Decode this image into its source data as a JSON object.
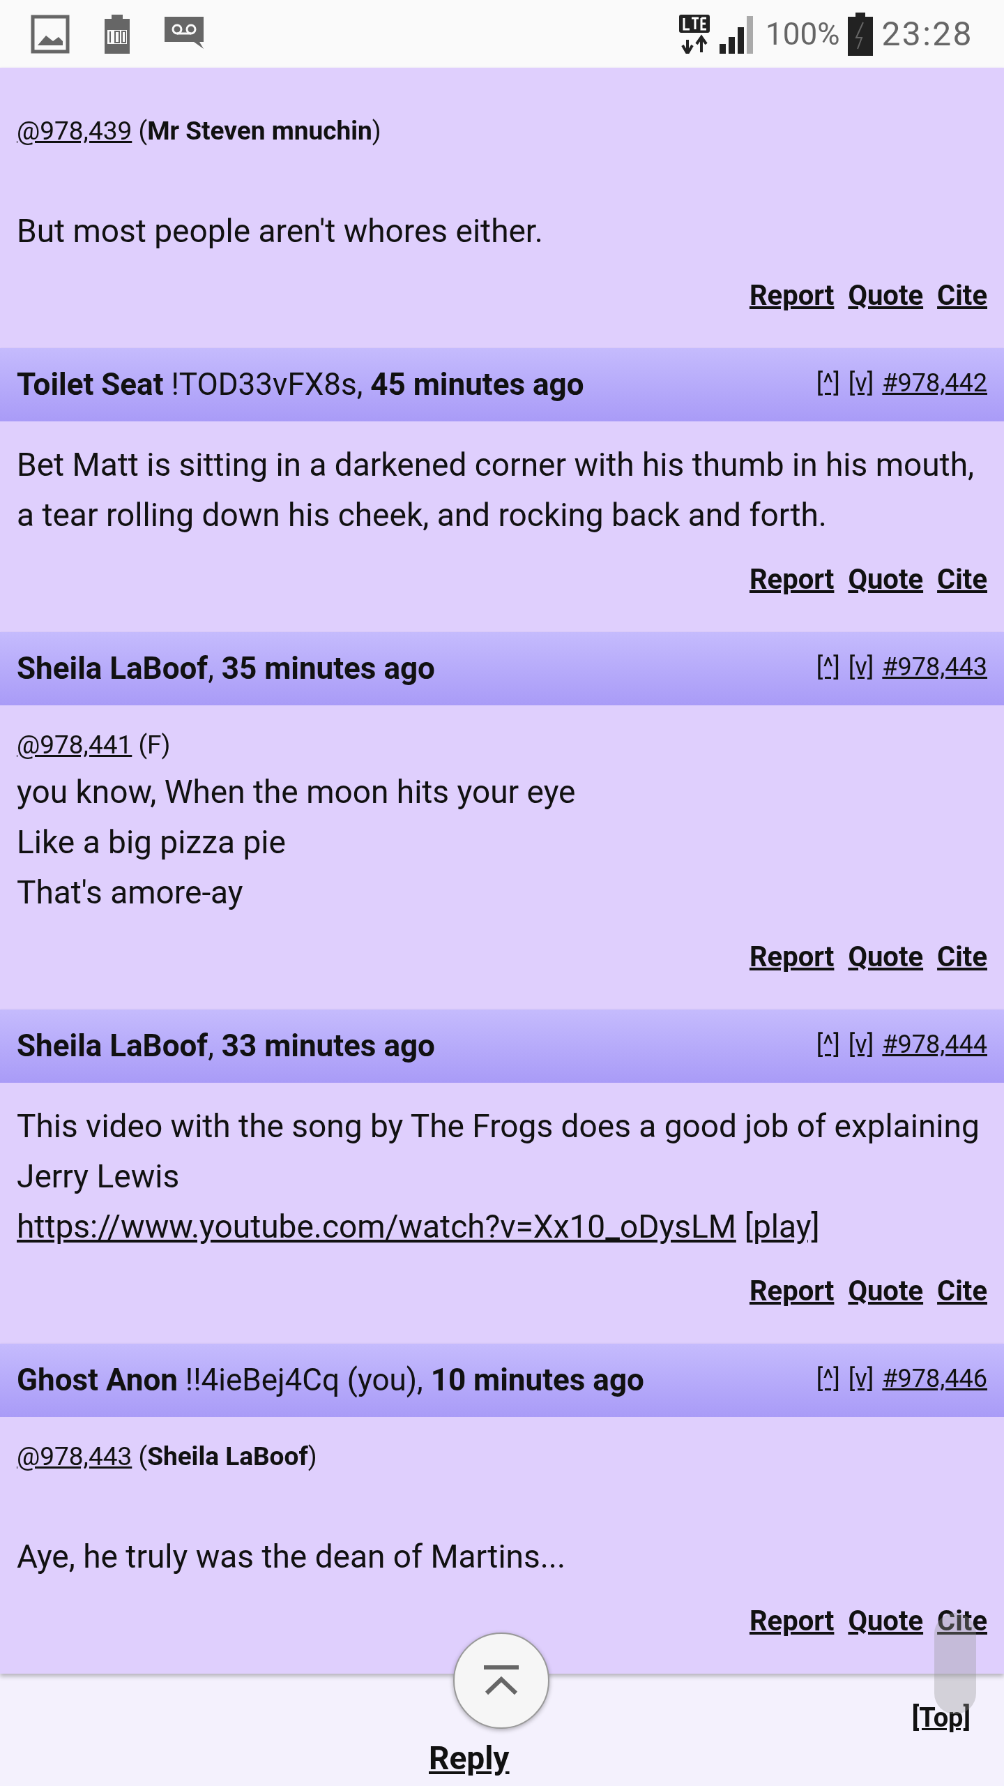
{
  "status_bar": {
    "battery": "100%",
    "time": "23:28"
  },
  "posts": [
    {
      "lines": [
        {
          "kind": "reference",
          "segments": [
            {
              "kind": "link",
              "text": "@978,439"
            },
            {
              "kind": "plain",
              "text": " ("
            },
            {
              "kind": "bold",
              "text": "Mr Steven mnuchin"
            },
            {
              "kind": "plain",
              "text": ")"
            }
          ]
        },
        {
          "kind": "paragraph",
          "segments": [
            {
              "kind": "plain",
              "text": "But most people aren't whores either."
            }
          ]
        }
      ],
      "actions": [
        "Report",
        "Quote",
        "Cite"
      ]
    },
    {
      "header": [
        {
          "kind": "bold",
          "text": "Toilet Seat"
        },
        {
          "kind": "plain",
          "text": " !TOD33vFX8s, "
        },
        {
          "kind": "bold",
          "text": "45 minutes ago"
        }
      ],
      "number_links": [
        "[^]",
        "[v]",
        "#978,442"
      ],
      "lines": [
        {
          "kind": "text",
          "segments": [
            {
              "kind": "plain",
              "text": "Bet Matt is sitting in a darkened corner with his thumb in his mouth, a tear rolling down his cheek, and rocking back and forth."
            }
          ]
        }
      ],
      "actions": [
        "Report",
        "Quote",
        "Cite"
      ]
    },
    {
      "header": [
        {
          "kind": "bold",
          "text": "Sheila LaBoof"
        },
        {
          "kind": "plain",
          "text": ", "
        },
        {
          "kind": "bold",
          "text": "35 minutes ago"
        }
      ],
      "number_links": [
        "[^]",
        "[v]",
        "#978,443"
      ],
      "lines": [
        {
          "kind": "reference",
          "segments": [
            {
              "kind": "link",
              "text": "@978,441"
            },
            {
              "kind": "plain",
              "text": " (F)"
            }
          ]
        },
        {
          "kind": "text",
          "segments": [
            {
              "kind": "plain",
              "text": "you know, When the moon hits your eye"
            }
          ]
        },
        {
          "kind": "text",
          "segments": [
            {
              "kind": "plain",
              "text": "Like a big pizza pie"
            }
          ]
        },
        {
          "kind": "text",
          "segments": [
            {
              "kind": "plain",
              "text": "That's amore-ay"
            }
          ]
        }
      ],
      "actions": [
        "Report",
        "Quote",
        "Cite"
      ]
    },
    {
      "header": [
        {
          "kind": "bold",
          "text": "Sheila LaBoof"
        },
        {
          "kind": "plain",
          "text": ", "
        },
        {
          "kind": "bold",
          "text": "33 minutes ago"
        }
      ],
      "number_links": [
        "[^]",
        "[v]",
        "#978,444"
      ],
      "lines": [
        {
          "kind": "text",
          "segments": [
            {
              "kind": "plain",
              "text": "This video with the song by The Frogs does a good job of explaining Jerry Lewis"
            }
          ]
        },
        {
          "kind": "text",
          "segments": [
            {
              "kind": "link",
              "text": "https://www.youtube.com/watch?v=Xx10_oDysLM"
            },
            {
              "kind": "link",
              "text": "[play]"
            }
          ]
        }
      ],
      "actions": [
        "Report",
        "Quote",
        "Cite"
      ]
    },
    {
      "header": [
        {
          "kind": "bold",
          "text": "Ghost Anon"
        },
        {
          "kind": "plain",
          "text": " !!4ieBej4Cq (you), "
        },
        {
          "kind": "bold",
          "text": "10 minutes ago"
        }
      ],
      "number_links": [
        "[^]",
        "[v]",
        "#978,446"
      ],
      "lines": [
        {
          "kind": "reference",
          "segments": [
            {
              "kind": "link",
              "text": "@978,443"
            },
            {
              "kind": "plain",
              "text": " ("
            },
            {
              "kind": "bold",
              "text": "Sheila LaBoof"
            },
            {
              "kind": "plain",
              "text": ")"
            }
          ]
        },
        {
          "kind": "paragraph",
          "segments": [
            {
              "kind": "plain",
              "text": "Aye, he truly was the dean of Martins..."
            }
          ]
        }
      ],
      "actions": [
        "Report",
        "Quote",
        "Cite"
      ]
    }
  ],
  "footer": {
    "reply": "Reply",
    "top": "[Top]"
  }
}
